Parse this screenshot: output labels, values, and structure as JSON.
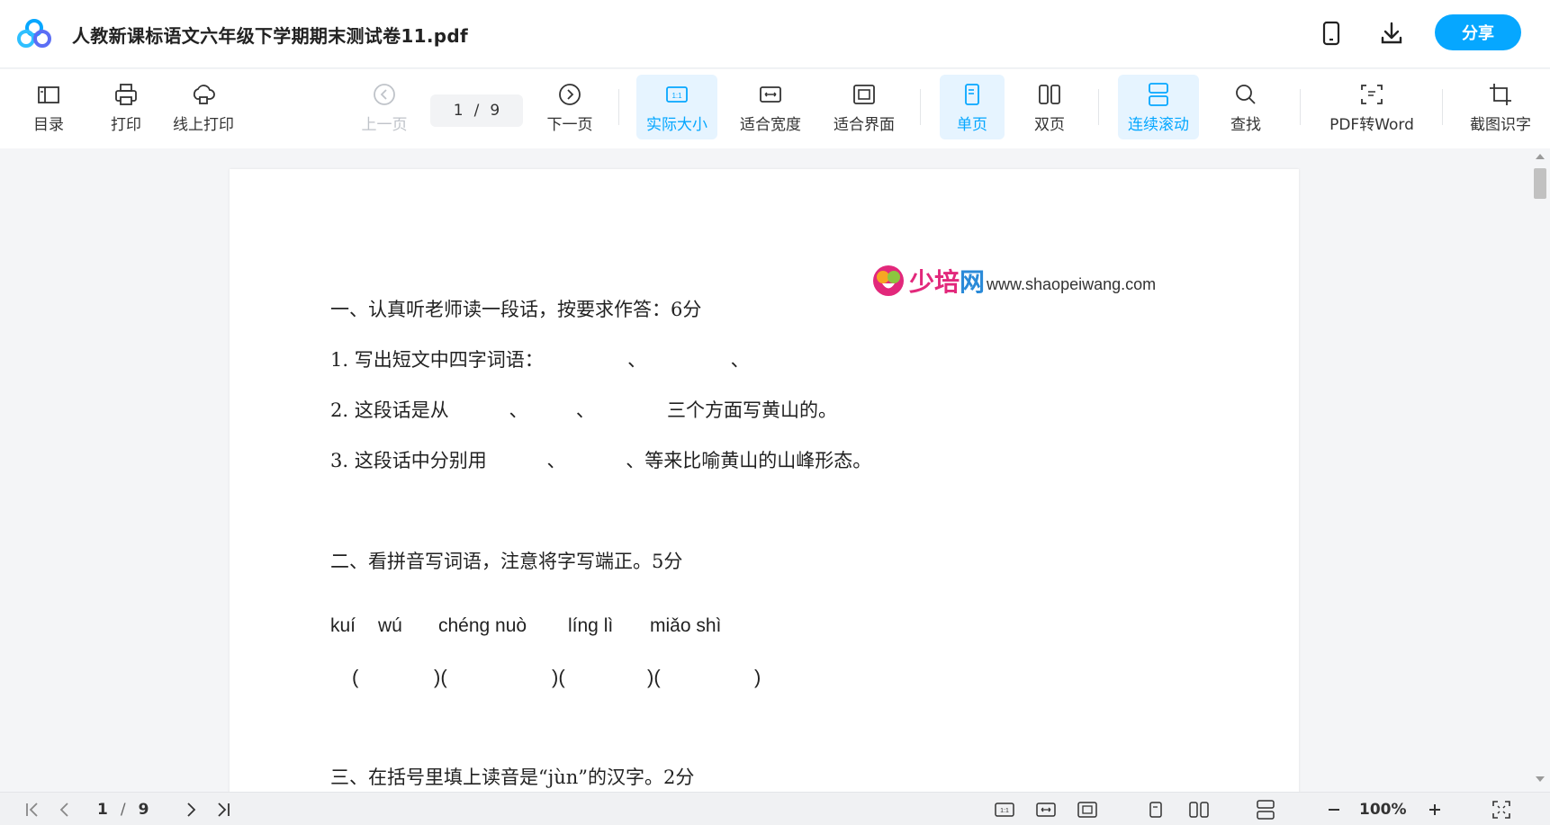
{
  "titlebar": {
    "document_title": "人教新课标语文六年级下学期期末测试卷11.pdf",
    "share_label": "分享",
    "icons": [
      "app-logo-icon",
      "mobile-icon",
      "download-icon"
    ]
  },
  "toolbar": {
    "catalog": "目录",
    "print": "打印",
    "online_print": "线上打印",
    "prev_page": "上一页",
    "current_page": "1",
    "page_sep": "/",
    "total_pages": "9",
    "next_page": "下一页",
    "actual_size": "实际大小",
    "fit_width": "适合宽度",
    "fit_screen": "适合界面",
    "single_page": "单页",
    "double_page": "双页",
    "continuous_scroll": "连续滚动",
    "find": "查找",
    "pdf_to_word": "PDF转Word",
    "screenshot_ocr": "截图识字",
    "accent_color": "#06a7ff"
  },
  "document": {
    "watermark_cn": "少培",
    "watermark_cn2": "网",
    "watermark_url": "www.shaopeiwang.com",
    "lines": [
      "一、认真听老师读一段话，按要求作答：6分",
      "1. 写出短文中四字词语：              、              、",
      "2. 这段话是从          、        、            三个方面写黄山的。",
      "3. 这段话中分别用          、          、等来比喻黄山的山峰形态。",
      "二、看拼音写词语，注意将字写端正。5分",
      "三、在括号里填上读音是“jùn”的汉字。2分"
    ],
    "pinyin": [
      "kuí",
      "wú",
      "chéng nuò",
      "líng lì",
      "miǎo shì"
    ],
    "parens": [
      "(",
      ")(",
      ")(",
      ")(",
      ")"
    ]
  },
  "statusbar": {
    "current_page": "1",
    "page_sep": "/",
    "total_pages": "9",
    "zoom": "100%"
  }
}
